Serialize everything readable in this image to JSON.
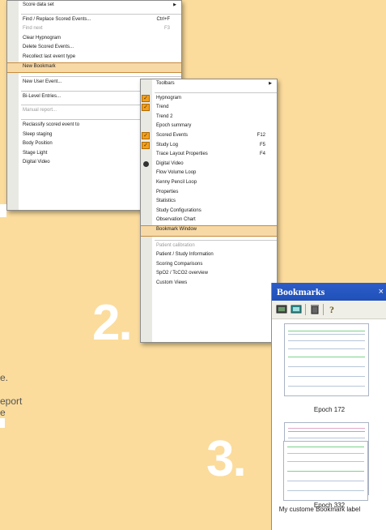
{
  "menu1": {
    "items": [
      {
        "label": "Score data set",
        "submenu": true
      },
      {
        "separator": true
      },
      {
        "label": "Find / Replace Scored Events...",
        "shortcut": "Ctrl+F"
      },
      {
        "label": "Find next",
        "shortcut": "F3",
        "disabled": true
      },
      {
        "label": "Clear Hypnogram"
      },
      {
        "label": "Delete Scored Events..."
      },
      {
        "label": "Recollect last event type"
      },
      {
        "label": "New Bookmark",
        "highlighted": true
      },
      {
        "separator": true
      },
      {
        "label": "New User Event..."
      },
      {
        "separator": true
      },
      {
        "label": "Bi-Level Entries..."
      },
      {
        "separator": true
      },
      {
        "label": "Manual report...",
        "disabled": true
      },
      {
        "separator": true
      },
      {
        "label": "Reclassify scored event to"
      },
      {
        "label": "Sleep staging"
      },
      {
        "label": "Body Position"
      },
      {
        "label": "Stage Light"
      },
      {
        "label": "Digital Video"
      }
    ]
  },
  "menu2": {
    "items": [
      {
        "label": "Toolbars",
        "submenu": true
      },
      {
        "separator": true
      },
      {
        "label": "Hypnogram",
        "checked": true
      },
      {
        "label": "Trend",
        "checked": true
      },
      {
        "label": "Trend 2"
      },
      {
        "label": "Epoch summary"
      },
      {
        "label": "Scored Events",
        "shortcut": "F12",
        "checked": true
      },
      {
        "label": "Study Log",
        "shortcut": "F5",
        "checked": true
      },
      {
        "label": "Trace Layout Properties",
        "shortcut": "F4"
      },
      {
        "label": "Digital Video",
        "dvicon": true
      },
      {
        "label": "Flow Volume Loop"
      },
      {
        "label": "Kenny Pencil Loop"
      },
      {
        "label": "Properties"
      },
      {
        "label": "Statistics"
      },
      {
        "label": "Study Configurations"
      },
      {
        "label": "Observation Chart"
      },
      {
        "label": "Bookmark Window",
        "highlighted": true
      },
      {
        "separator": true
      },
      {
        "label": "Patient calibration",
        "disabled": true
      },
      {
        "label": "Patient / Study Information"
      },
      {
        "label": "Scoring Comparisons"
      },
      {
        "label": "SpO2 / TcCO2 overview"
      },
      {
        "label": "Custom Views"
      }
    ]
  },
  "steps": {
    "two": "2.",
    "three": "3."
  },
  "sidetext": {
    "line1": "e.",
    "line2": "eport",
    "line3": "e"
  },
  "bookmarks": {
    "title": "Bookmarks",
    "close": "×",
    "toolbar_icons": [
      "bookmark-go-icon",
      "bookmark-screen-icon",
      "delete-icon",
      "help-icon"
    ],
    "items": [
      {
        "label": "Epoch 172"
      },
      {
        "label": "Epoch 332"
      },
      {
        "label": "My custome Bookmark label"
      }
    ]
  },
  "colors": {
    "background": "#fbdc9c",
    "highlight": "#f7d9a6",
    "check": "#f0a020",
    "titlebar": "#2d5cc8"
  }
}
